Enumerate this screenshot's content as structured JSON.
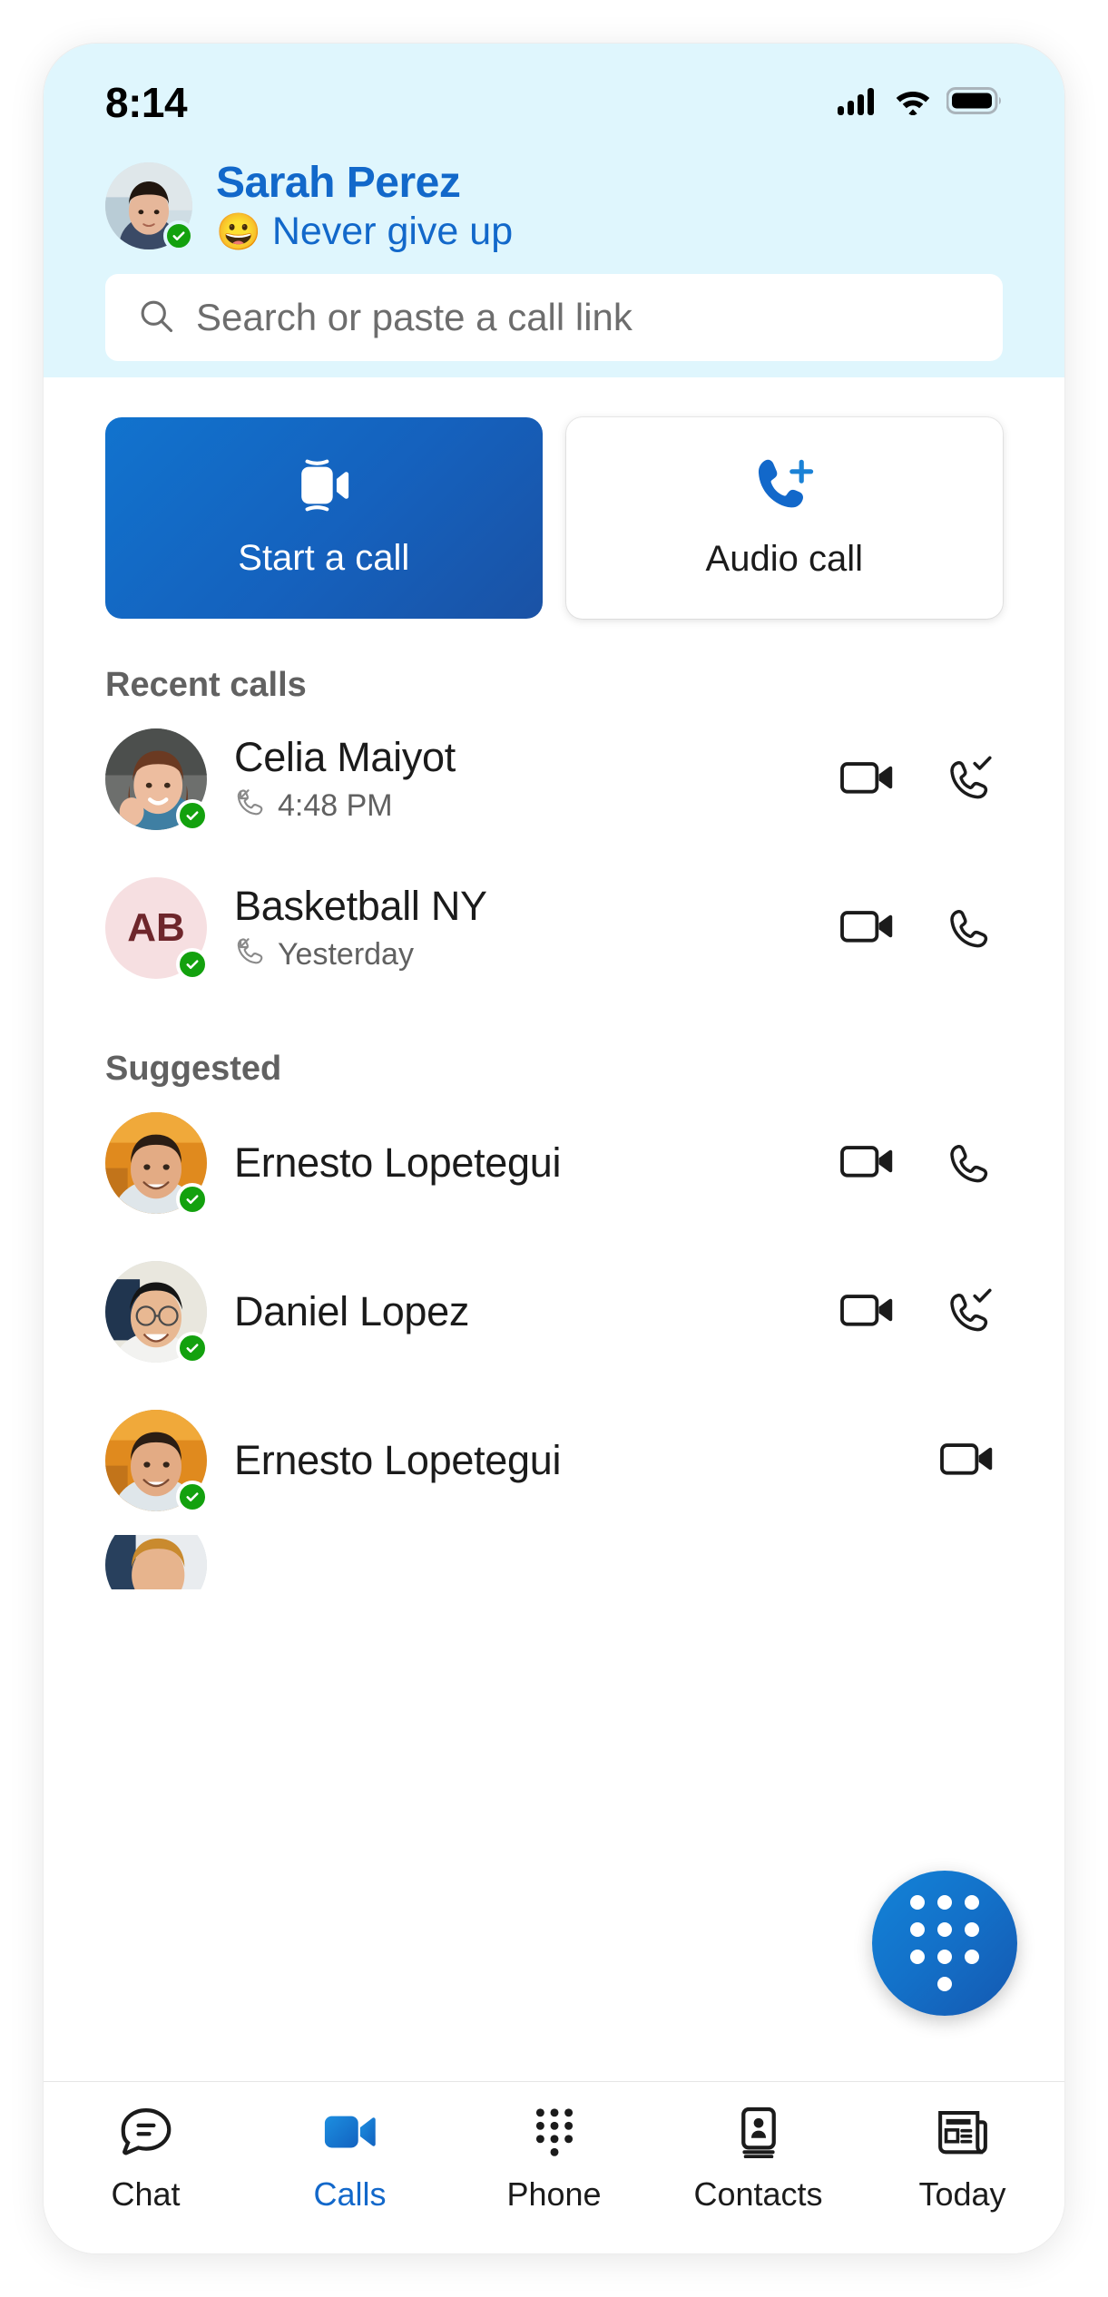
{
  "status_bar": {
    "time": "8:14",
    "icons": [
      "cellular-signal-icon",
      "wifi-icon",
      "battery-icon"
    ]
  },
  "profile": {
    "name": "Sarah Perez",
    "mood_emoji": "😀",
    "mood_text": "Never give up",
    "presence": "available",
    "avatar_alt": "avatar"
  },
  "search": {
    "placeholder": "Search or paste a call link",
    "icon": "search-icon"
  },
  "actions": {
    "primary": {
      "label": "Start a call",
      "icon": "video-call-icon"
    },
    "secondary": {
      "label": "Audio call",
      "icon": "phone-add-icon"
    }
  },
  "sections": [
    {
      "title": "Recent calls",
      "rows": [
        {
          "name": "Celia Maiyot",
          "sub": "4:48 PM",
          "sub_icon": "call-incoming-icon",
          "presence": "available",
          "avatar_type": "photo",
          "avatar_key": "celia",
          "video_icon": "video-icon",
          "call_icon": "phone-check-icon"
        },
        {
          "name": "Basketball NY",
          "sub": "Yesterday",
          "sub_icon": "call-incoming-icon",
          "presence": "available",
          "avatar_type": "initials",
          "initials": "AB",
          "avatar_bg": "#f6dfe1",
          "avatar_fg": "#6e262b",
          "video_icon": "video-icon",
          "call_icon": "phone-icon"
        }
      ]
    },
    {
      "title": "Suggested",
      "rows": [
        {
          "name": "Ernesto Lopetegui",
          "sub": "",
          "sub_icon": "",
          "presence": "available",
          "avatar_type": "photo",
          "avatar_key": "ernesto",
          "video_icon": "video-icon",
          "call_icon": "phone-icon"
        },
        {
          "name": "Daniel Lopez",
          "sub": "",
          "sub_icon": "",
          "presence": "available",
          "avatar_type": "photo",
          "avatar_key": "daniel",
          "video_icon": "video-icon",
          "call_icon": "phone-check-icon"
        },
        {
          "name": "Ernesto Lopetegui",
          "sub": "",
          "sub_icon": "",
          "presence": "available",
          "avatar_type": "photo",
          "avatar_key": "ernesto",
          "video_icon": "video-icon",
          "call_icon": ""
        }
      ]
    }
  ],
  "fab": {
    "icon": "dialpad-icon"
  },
  "bottom_nav": {
    "items": [
      {
        "label": "Chat",
        "icon": "chat-icon",
        "active": false
      },
      {
        "label": "Calls",
        "icon": "calls-icon",
        "active": true
      },
      {
        "label": "Phone",
        "icon": "dialpad-icon",
        "active": false
      },
      {
        "label": "Contacts",
        "icon": "contacts-icon",
        "active": false
      },
      {
        "label": "Today",
        "icon": "today-icon",
        "active": false
      }
    ]
  },
  "colors": {
    "header_bg": "#dff6fd",
    "accent_blue": "#1268ca",
    "presence_green": "#13a10e",
    "text_primary": "#1b1b1b",
    "text_secondary": "#616161"
  }
}
